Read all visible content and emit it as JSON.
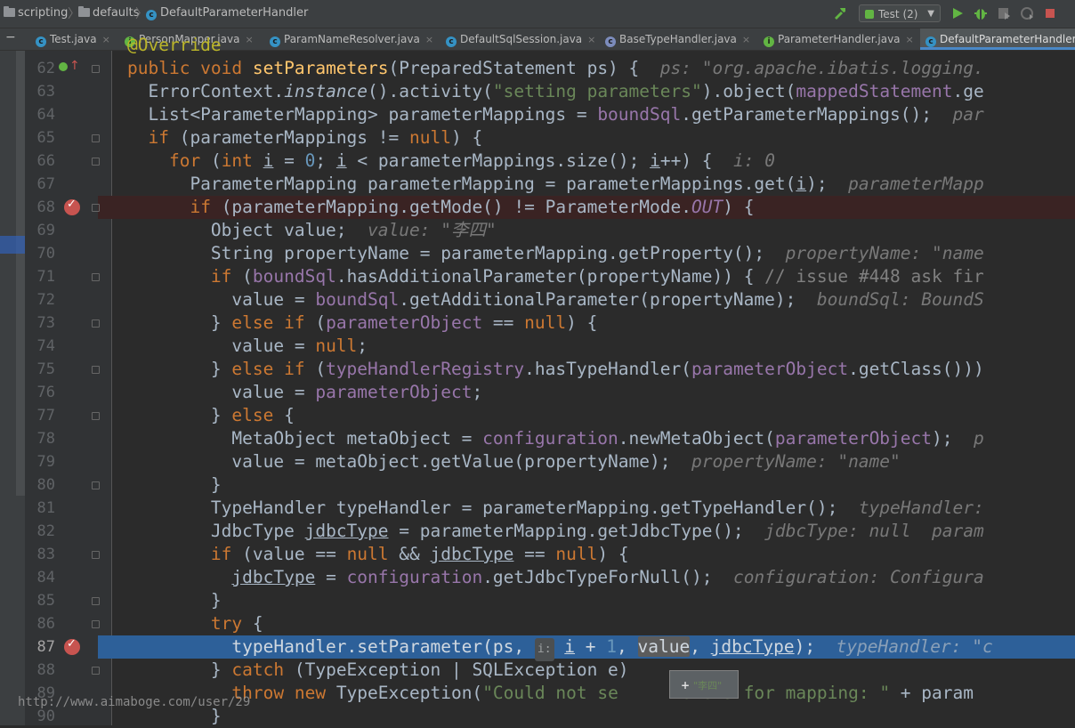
{
  "breadcrumb": {
    "items": [
      "scripting",
      "defaults",
      "DefaultParameterHandler"
    ]
  },
  "toolbar": {
    "run_config": "Test (2)",
    "icons": [
      "hammer-icon",
      "run-icon",
      "debug-icon",
      "coverage-icon",
      "profile-icon",
      "stop-icon"
    ]
  },
  "tabs": [
    {
      "label": "Test.java",
      "icon": "class"
    },
    {
      "label": "PersonMapper.java",
      "icon": "interface"
    },
    {
      "label": "ParamNameResolver.java",
      "icon": "class"
    },
    {
      "label": "DefaultSqlSession.java",
      "icon": "class"
    },
    {
      "label": "BaseTypeHandler.java",
      "icon": "abstract-class"
    },
    {
      "label": "ParameterHandler.java",
      "icon": "interface"
    },
    {
      "label": "DefaultParameterHandler.",
      "icon": "class",
      "active": true
    }
  ],
  "lines": [
    {
      "n": "62"
    },
    {
      "n": "63"
    },
    {
      "n": "64"
    },
    {
      "n": "65"
    },
    {
      "n": "66"
    },
    {
      "n": "67"
    },
    {
      "n": "68"
    },
    {
      "n": "69"
    },
    {
      "n": "70"
    },
    {
      "n": "71"
    },
    {
      "n": "72"
    },
    {
      "n": "73"
    },
    {
      "n": "74"
    },
    {
      "n": "75"
    },
    {
      "n": "76"
    },
    {
      "n": "77"
    },
    {
      "n": "78"
    },
    {
      "n": "79"
    },
    {
      "n": "80"
    },
    {
      "n": "81"
    },
    {
      "n": "82"
    },
    {
      "n": "83"
    },
    {
      "n": "84"
    },
    {
      "n": "85"
    },
    {
      "n": "86"
    },
    {
      "n": "87"
    },
    {
      "n": "88"
    },
    {
      "n": "89"
    },
    {
      "n": "90"
    }
  ],
  "code": {
    "l61": "@Override",
    "l62_hint": "ps: \"org.apache.ibatis.logging.",
    "l63_str": "\"setting parameters\"",
    "l64_hint": "par",
    "l66_hint": "i: 0",
    "l67_hint": "parameterMapp",
    "l69_hint": "value: \"李四\"",
    "l70_hint": "propertyName: \"name",
    "l71_cmt": "// issue #448 ask fir",
    "l72_hint": "boundSql: BoundS",
    "l78_hint": "p",
    "l79_hint": "propertyName: \"name\"",
    "l81_hint": "typeHandler:",
    "l82_hint": "jdbcType: null  param",
    "l84_hint": "configuration: Configura",
    "l87_hint": "typeHandler: \"c",
    "l89_str": "\"Could not se",
    "l89_str2": "meters for mapping: \""
  },
  "tooltip": {
    "value": "\"李四\""
  },
  "watermark": "http://www.aimaboge.com/user/29"
}
